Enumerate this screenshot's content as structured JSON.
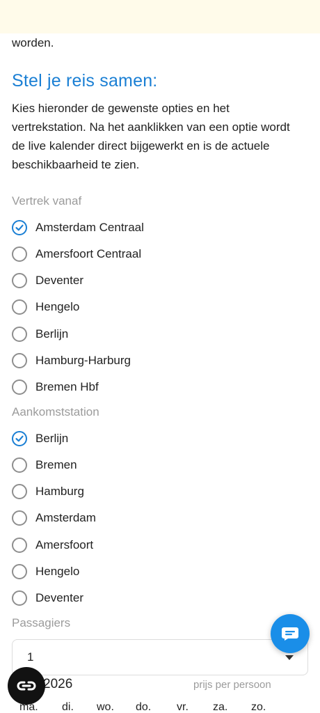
{
  "intro_tail": "worden.",
  "section": {
    "title": "Stel je reis samen:",
    "description": "Kies hieronder de gewenste opties en het vertrekstation. Na het aanklikken van een optie wordt de live kalender direct bijgewerkt en is de actuele beschikbaarheid te zien."
  },
  "departure": {
    "label": "Vertrek vanaf",
    "options": [
      {
        "label": "Amsterdam Centraal",
        "checked": true
      },
      {
        "label": "Amersfoort Centraal",
        "checked": false
      },
      {
        "label": "Deventer",
        "checked": false
      },
      {
        "label": "Hengelo",
        "checked": false
      },
      {
        "label": "Berlijn",
        "checked": false
      },
      {
        "label": "Hamburg-Harburg",
        "checked": false
      },
      {
        "label": "Bremen Hbf",
        "checked": false
      }
    ]
  },
  "arrival": {
    "label": "Aankomststation",
    "options": [
      {
        "label": "Berlijn",
        "checked": true
      },
      {
        "label": "Bremen",
        "checked": false
      },
      {
        "label": "Hamburg",
        "checked": false
      },
      {
        "label": "Amsterdam",
        "checked": false
      },
      {
        "label": "Amersfoort",
        "checked": false
      },
      {
        "label": "Hengelo",
        "checked": false
      },
      {
        "label": "Deventer",
        "checked": false
      }
    ]
  },
  "passengers": {
    "label": "Passagiers",
    "value": "1"
  },
  "calendar": {
    "year_text": "2026",
    "price_note": "prijs per persoon",
    "weekdays": [
      "ma.",
      "di.",
      "wo.",
      "do.",
      "vr.",
      "za.",
      "zo."
    ]
  },
  "colors": {
    "accent": "#1a7fd4",
    "banner": "#fffbea",
    "chat_button": "#1a8ee8",
    "muted_label": "#9b9b9b"
  },
  "icons": {
    "check": "check-icon",
    "chat": "chat-icon",
    "link": "link-icon",
    "caret": "chevron-down-icon"
  }
}
